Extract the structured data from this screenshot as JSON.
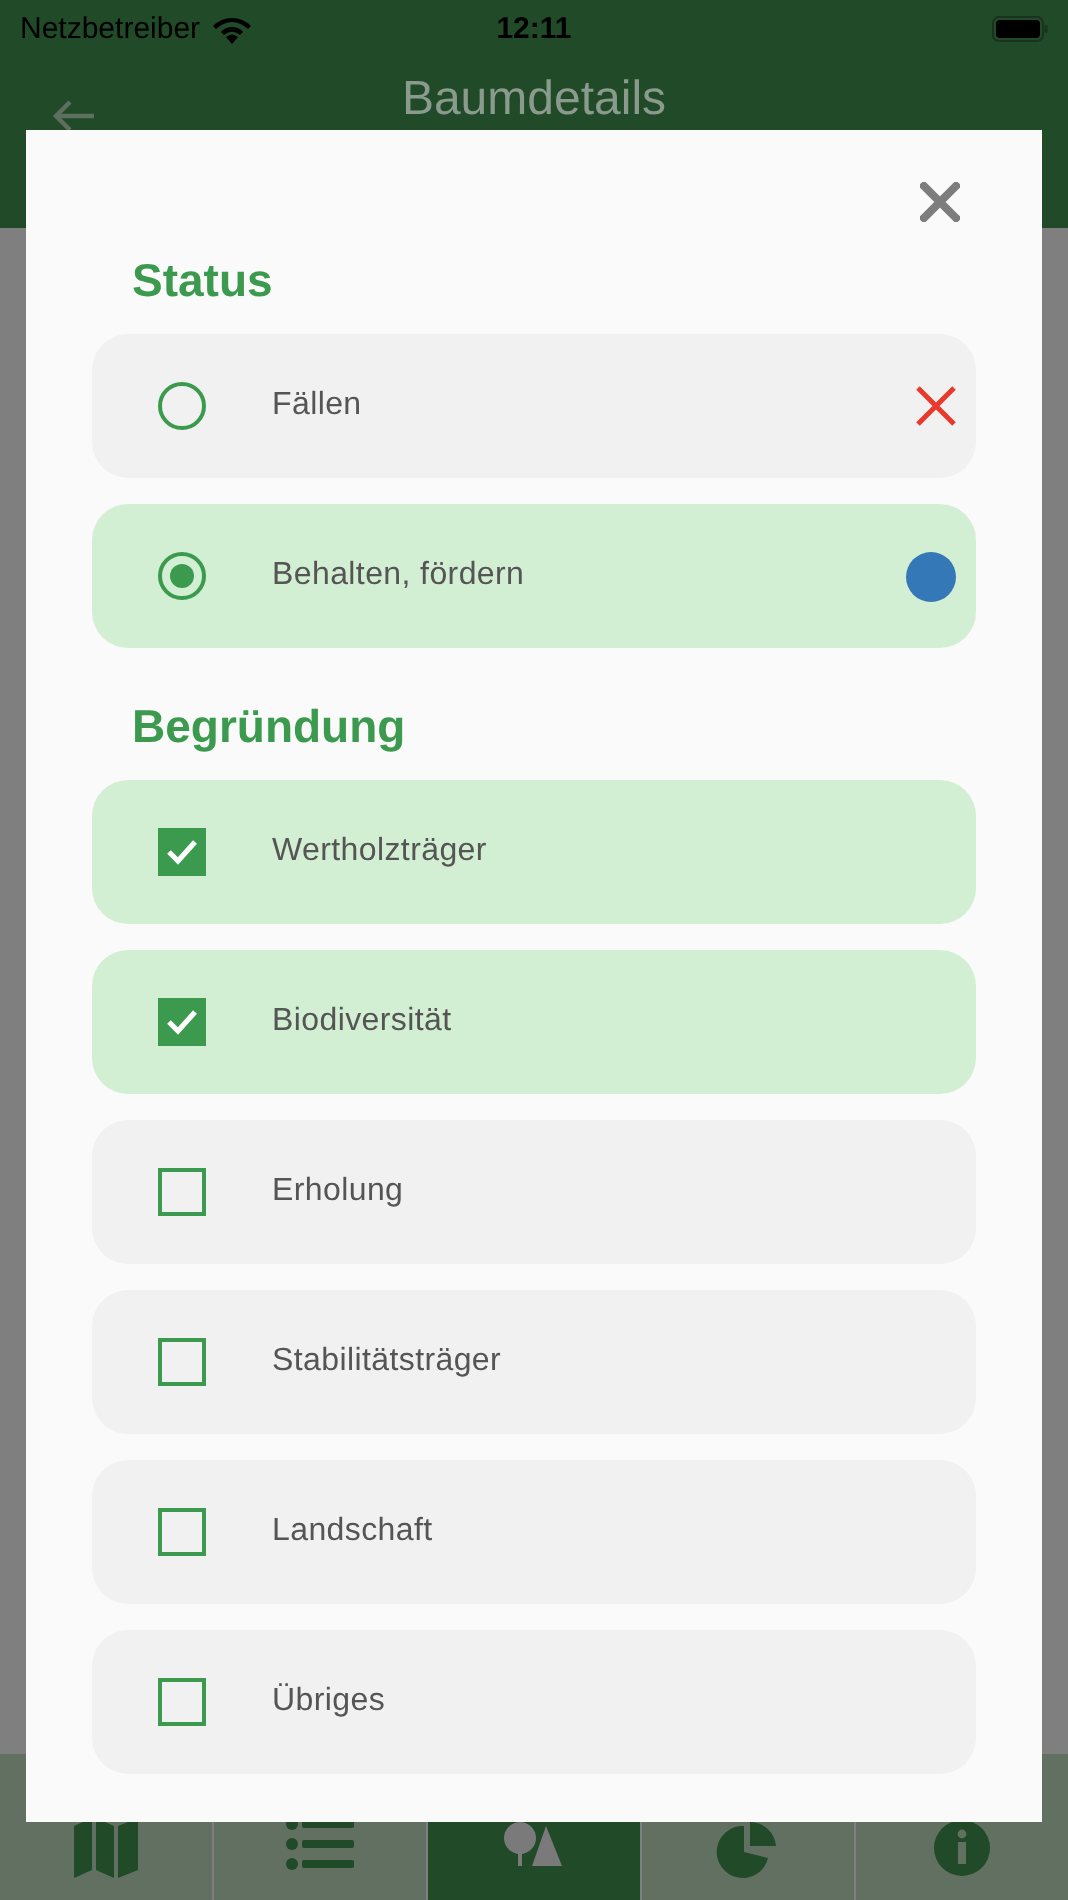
{
  "status_bar": {
    "carrier": "Netzbetreiber",
    "time": "12:11"
  },
  "app_bar": {
    "title": "Baumdetails"
  },
  "dialog": {
    "status": {
      "heading": "Status",
      "options": [
        {
          "label": "Fällen",
          "selected": false,
          "kind": "cross",
          "color": "#e8392c"
        },
        {
          "label": "Behalten, fördern",
          "selected": true,
          "kind": "dot",
          "color": "#3478b8"
        }
      ]
    },
    "reasons": {
      "heading": "Begründung",
      "items": [
        {
          "label": "Wertholzträger",
          "checked": true
        },
        {
          "label": "Biodiversität",
          "checked": true
        },
        {
          "label": "Erholung",
          "checked": false
        },
        {
          "label": "Stabilitätsträger",
          "checked": false
        },
        {
          "label": "Landschaft",
          "checked": false
        },
        {
          "label": "Übriges",
          "checked": false
        }
      ]
    }
  },
  "tab_bar": {
    "tabs": [
      {
        "kind": "map",
        "selected": false
      },
      {
        "kind": "list",
        "selected": false
      },
      {
        "kind": "tree",
        "selected": true
      },
      {
        "kind": "chart",
        "selected": false
      },
      {
        "kind": "info",
        "selected": false
      }
    ]
  }
}
